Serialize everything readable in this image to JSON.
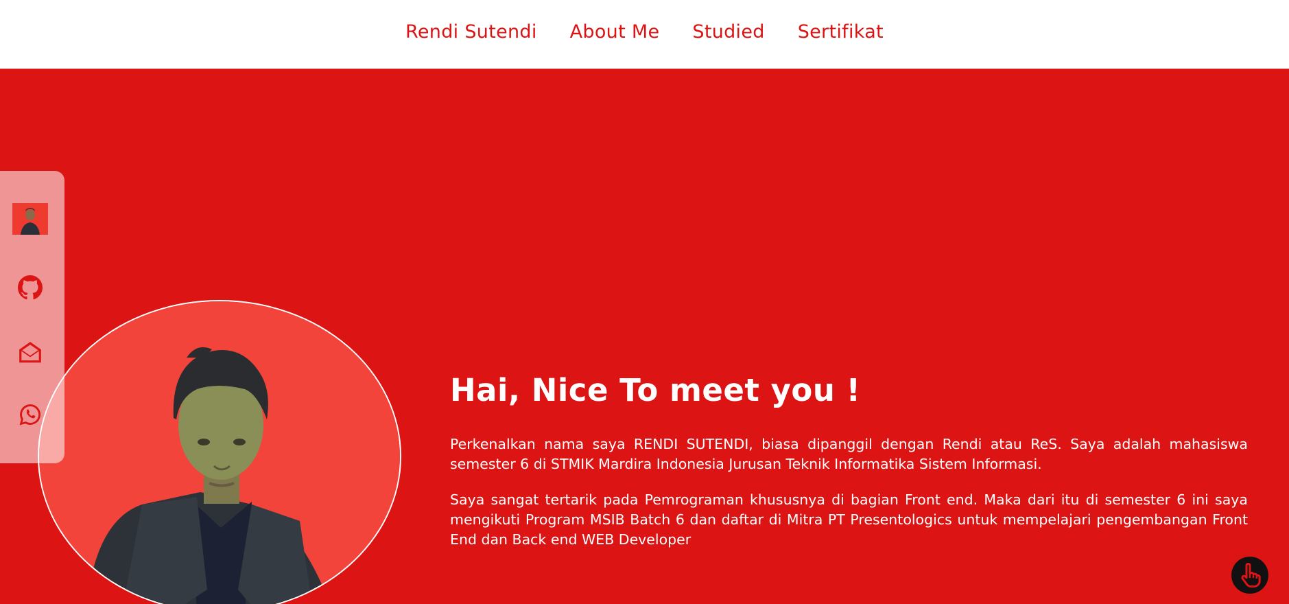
{
  "nav": {
    "items": [
      {
        "label": "Rendi Sutendi"
      },
      {
        "label": "About Me"
      },
      {
        "label": "Studied"
      },
      {
        "label": "Sertifikat"
      }
    ]
  },
  "sidebar": {
    "icons": [
      "avatar-thumbnail",
      "github-icon",
      "mail-icon",
      "whatsapp-icon"
    ]
  },
  "hero": {
    "heading": "Hai, Nice To meet you !",
    "paragraphs": [
      "Perkenalkan nama saya RENDI SUTENDI, biasa dipanggil dengan Rendi atau ReS. Saya adalah mahasiswa semester 6 di STMIK Mardira Indonesia Jurusan Teknik Informatika Sistem Informasi.",
      "Saya sangat tertarik pada Pemrograman khususnya di bagian Front end. Maka dari itu di semester 6 ini saya mengikuti Program MSIB Batch 6 dan daftar di Mitra PT Presentologics untuk mempelajari pengembangan Front End dan Back end WEB Developer"
    ]
  },
  "colors": {
    "brand_red": "#dc1414",
    "photo_bg": "#f2443a",
    "nav_bg": "#ffffff"
  }
}
